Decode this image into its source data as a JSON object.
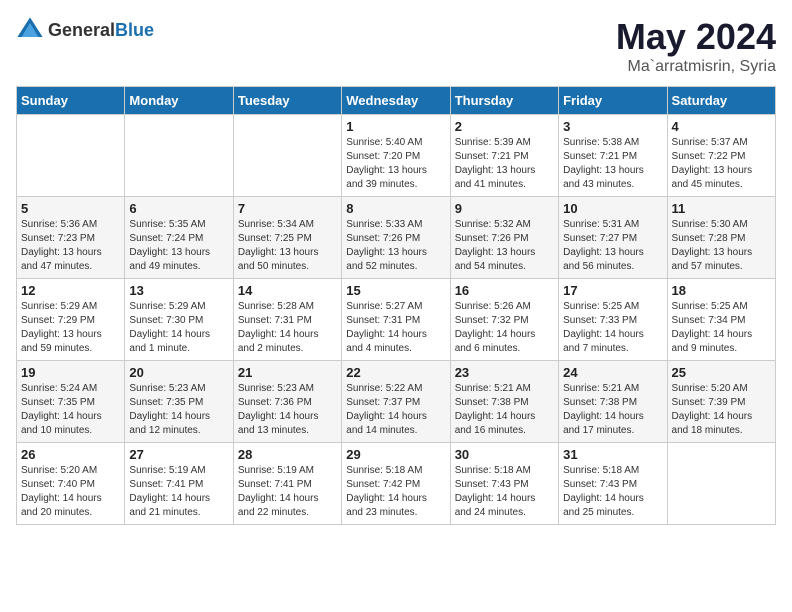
{
  "header": {
    "logo": {
      "general": "General",
      "blue": "Blue"
    },
    "title": "May 2024",
    "location": "Ma`arratmisrin, Syria"
  },
  "days_of_week": [
    "Sunday",
    "Monday",
    "Tuesday",
    "Wednesday",
    "Thursday",
    "Friday",
    "Saturday"
  ],
  "weeks": [
    [
      {
        "day": "",
        "info": ""
      },
      {
        "day": "",
        "info": ""
      },
      {
        "day": "",
        "info": ""
      },
      {
        "day": "1",
        "info": "Sunrise: 5:40 AM\nSunset: 7:20 PM\nDaylight: 13 hours and 39 minutes."
      },
      {
        "day": "2",
        "info": "Sunrise: 5:39 AM\nSunset: 7:21 PM\nDaylight: 13 hours and 41 minutes."
      },
      {
        "day": "3",
        "info": "Sunrise: 5:38 AM\nSunset: 7:21 PM\nDaylight: 13 hours and 43 minutes."
      },
      {
        "day": "4",
        "info": "Sunrise: 5:37 AM\nSunset: 7:22 PM\nDaylight: 13 hours and 45 minutes."
      }
    ],
    [
      {
        "day": "5",
        "info": "Sunrise: 5:36 AM\nSunset: 7:23 PM\nDaylight: 13 hours and 47 minutes."
      },
      {
        "day": "6",
        "info": "Sunrise: 5:35 AM\nSunset: 7:24 PM\nDaylight: 13 hours and 49 minutes."
      },
      {
        "day": "7",
        "info": "Sunrise: 5:34 AM\nSunset: 7:25 PM\nDaylight: 13 hours and 50 minutes."
      },
      {
        "day": "8",
        "info": "Sunrise: 5:33 AM\nSunset: 7:26 PM\nDaylight: 13 hours and 52 minutes."
      },
      {
        "day": "9",
        "info": "Sunrise: 5:32 AM\nSunset: 7:26 PM\nDaylight: 13 hours and 54 minutes."
      },
      {
        "day": "10",
        "info": "Sunrise: 5:31 AM\nSunset: 7:27 PM\nDaylight: 13 hours and 56 minutes."
      },
      {
        "day": "11",
        "info": "Sunrise: 5:30 AM\nSunset: 7:28 PM\nDaylight: 13 hours and 57 minutes."
      }
    ],
    [
      {
        "day": "12",
        "info": "Sunrise: 5:29 AM\nSunset: 7:29 PM\nDaylight: 13 hours and 59 minutes."
      },
      {
        "day": "13",
        "info": "Sunrise: 5:29 AM\nSunset: 7:30 PM\nDaylight: 14 hours and 1 minute."
      },
      {
        "day": "14",
        "info": "Sunrise: 5:28 AM\nSunset: 7:31 PM\nDaylight: 14 hours and 2 minutes."
      },
      {
        "day": "15",
        "info": "Sunrise: 5:27 AM\nSunset: 7:31 PM\nDaylight: 14 hours and 4 minutes."
      },
      {
        "day": "16",
        "info": "Sunrise: 5:26 AM\nSunset: 7:32 PM\nDaylight: 14 hours and 6 minutes."
      },
      {
        "day": "17",
        "info": "Sunrise: 5:25 AM\nSunset: 7:33 PM\nDaylight: 14 hours and 7 minutes."
      },
      {
        "day": "18",
        "info": "Sunrise: 5:25 AM\nSunset: 7:34 PM\nDaylight: 14 hours and 9 minutes."
      }
    ],
    [
      {
        "day": "19",
        "info": "Sunrise: 5:24 AM\nSunset: 7:35 PM\nDaylight: 14 hours and 10 minutes."
      },
      {
        "day": "20",
        "info": "Sunrise: 5:23 AM\nSunset: 7:35 PM\nDaylight: 14 hours and 12 minutes."
      },
      {
        "day": "21",
        "info": "Sunrise: 5:23 AM\nSunset: 7:36 PM\nDaylight: 14 hours and 13 minutes."
      },
      {
        "day": "22",
        "info": "Sunrise: 5:22 AM\nSunset: 7:37 PM\nDaylight: 14 hours and 14 minutes."
      },
      {
        "day": "23",
        "info": "Sunrise: 5:21 AM\nSunset: 7:38 PM\nDaylight: 14 hours and 16 minutes."
      },
      {
        "day": "24",
        "info": "Sunrise: 5:21 AM\nSunset: 7:38 PM\nDaylight: 14 hours and 17 minutes."
      },
      {
        "day": "25",
        "info": "Sunrise: 5:20 AM\nSunset: 7:39 PM\nDaylight: 14 hours and 18 minutes."
      }
    ],
    [
      {
        "day": "26",
        "info": "Sunrise: 5:20 AM\nSunset: 7:40 PM\nDaylight: 14 hours and 20 minutes."
      },
      {
        "day": "27",
        "info": "Sunrise: 5:19 AM\nSunset: 7:41 PM\nDaylight: 14 hours and 21 minutes."
      },
      {
        "day": "28",
        "info": "Sunrise: 5:19 AM\nSunset: 7:41 PM\nDaylight: 14 hours and 22 minutes."
      },
      {
        "day": "29",
        "info": "Sunrise: 5:18 AM\nSunset: 7:42 PM\nDaylight: 14 hours and 23 minutes."
      },
      {
        "day": "30",
        "info": "Sunrise: 5:18 AM\nSunset: 7:43 PM\nDaylight: 14 hours and 24 minutes."
      },
      {
        "day": "31",
        "info": "Sunrise: 5:18 AM\nSunset: 7:43 PM\nDaylight: 14 hours and 25 minutes."
      },
      {
        "day": "",
        "info": ""
      }
    ]
  ]
}
